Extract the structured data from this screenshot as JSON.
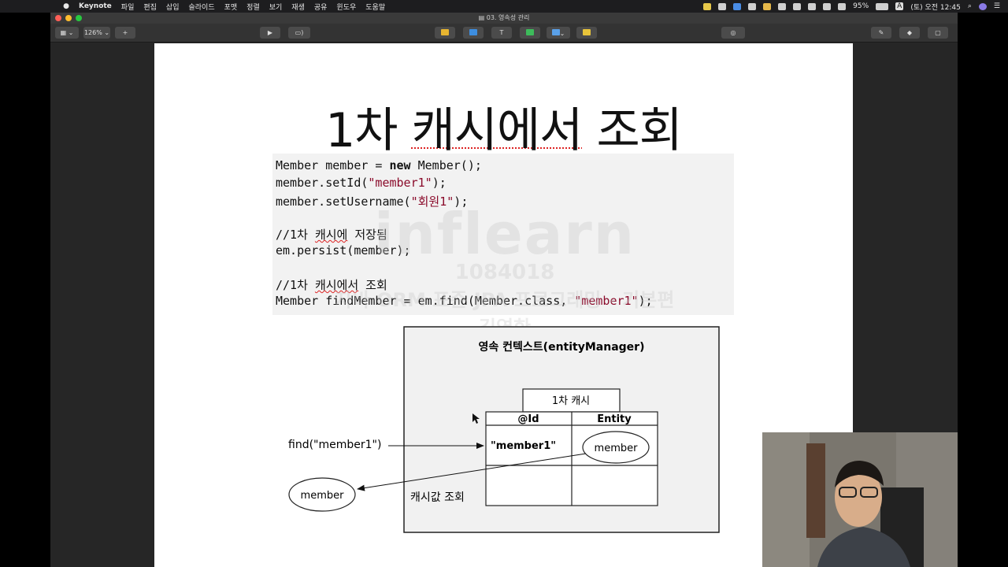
{
  "menubar": {
    "app": "Keynote",
    "menus": [
      "파일",
      "편집",
      "삽입",
      "슬라이드",
      "포맷",
      "정렬",
      "보기",
      "재생",
      "공유",
      "윈도우",
      "도움말"
    ],
    "battery": "95%",
    "input_mode": "A",
    "clock": "(토) 오전 12:45"
  },
  "window": {
    "title": "03. 영속성 관리",
    "zoom": "126%"
  },
  "slide": {
    "title": "1차 캐시에서 조회",
    "title_squiggle": "캐시에서",
    "title_tail": "조회",
    "title_head": "1차",
    "code": {
      "l1a": "Member member = ",
      "l1kw": "new",
      "l1b": " Member();",
      "l2a": "member.setId(",
      "l2s": "\"member1\"",
      "l2b": ");",
      "l3a": "member.setUsername(",
      "l3s": "\"회원1\"",
      "l3b": ");",
      "c1a": "//1차 ",
      "c1sq": "캐시에",
      "c1b": " 저장됨",
      "l4": "em.persist(member);",
      "c2a": "//1차 ",
      "c2sq": "캐시에서",
      "c2b": " 조회",
      "l5a": "Member findMember = em.find(Member.class, ",
      "l5s": "\"member1\"",
      "l5b": ");"
    },
    "watermark": {
      "brand": "inflearn",
      "number": "1084018",
      "line1": "자바 ORM 표준 JPA 프로그래밍 - 기본편",
      "line2": "김영한"
    },
    "diagram": {
      "context_label": "영속 컨텍스트(entityManager)",
      "cache_label": "1차 캐시",
      "col_id": "@Id",
      "col_entity": "Entity",
      "row1_id": "\"member1\"",
      "row1_entity": "member",
      "find_call": "find(\"member1\")",
      "result": "member",
      "lookup_label": "캐시값 조회"
    }
  }
}
